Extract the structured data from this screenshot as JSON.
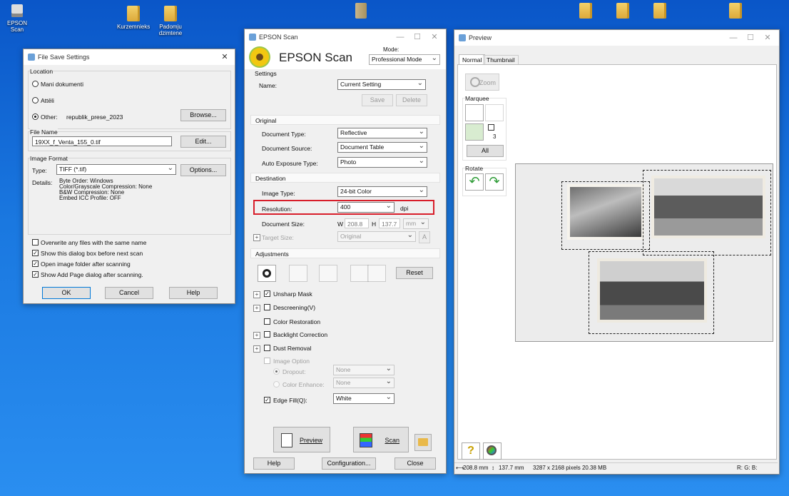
{
  "desktop": {
    "icons": [
      {
        "label": "EPSON Scan"
      },
      {
        "label": "Kurzemnieks"
      },
      {
        "label": "Padomju dzimtene"
      }
    ]
  },
  "file_save": {
    "title": "File Save Settings",
    "location_label": "Location",
    "opt1": "Mani dokumenti",
    "opt2": "Attēli",
    "opt3": "Other:",
    "other_path": "republik_prese_2023",
    "browse": "Browse...",
    "filename_label": "File Name",
    "filename_value": "19XX_f_Venta_155_0.tif",
    "edit": "Edit...",
    "format_label": "Image Format",
    "type_label": "Type:",
    "type_value": "TIFF (*.tif)",
    "options": "Options...",
    "details_label": "Details:",
    "details": [
      "Byte Order: Windows",
      "Color/Grayscale Compression: None",
      "B&W Compression: None",
      "Embed ICC Profile: OFF"
    ],
    "cb1": "Overwrite any files with the same name",
    "cb2": "Show this dialog box before next scan",
    "cb3": "Open image folder after scanning",
    "cb4": "Show Add Page dialog after scanning.",
    "ok": "OK",
    "cancel": "Cancel",
    "help": "Help"
  },
  "epson": {
    "title": "EPSON Scan",
    "brand": "EPSON Scan",
    "mode_label": "Mode:",
    "mode_value": "Professional Mode",
    "settings_label": "Settings",
    "name_label": "Name:",
    "name_value": "Current Setting",
    "save": "Save",
    "delete": "Delete",
    "original": "Original",
    "doc_type_label": "Document Type:",
    "doc_type": "Reflective",
    "doc_source_label": "Document Source:",
    "doc_source": "Document Table",
    "auto_exp_label": "Auto Exposure Type:",
    "auto_exp": "Photo",
    "destination": "Destination",
    "image_type_label": "Image Type:",
    "image_type": "24-bit Color",
    "resolution_label": "Resolution:",
    "resolution": "400",
    "dpi": "dpi",
    "doc_size_label": "Document Size:",
    "w": "W",
    "w_val": "208.8",
    "h": "H",
    "h_val": "137.7",
    "unit": "mm",
    "target_size_label": "Target Size:",
    "target_size": "Original",
    "adjustments": "Adjustments",
    "reset": "Reset",
    "unsharp": "Unsharp Mask",
    "descreening": "Descreening(V)",
    "color_restoration": "Color Restoration",
    "backlight": "Backlight Correction",
    "dust": "Dust Removal",
    "image_option": "Image Option",
    "dropout": "Dropout:",
    "dropout_val": "None",
    "color_enhance": "Color Enhance:",
    "color_enhance_val": "None",
    "edge_fill": "Edge Fill(Q):",
    "edge_fill_val": "White",
    "preview": "Preview",
    "scan": "Scan",
    "help": "Help",
    "configuration": "Configuration...",
    "close": "Close"
  },
  "preview": {
    "title": "Preview",
    "tab_normal": "Normal",
    "tab_thumb": "Thumbnail",
    "zoom": "Zoom",
    "marquee": "Marquee",
    "marquee_count": "3",
    "all": "All",
    "rotate": "Rotate",
    "status_size": "208.8 mm",
    "status_height": "137.7 mm",
    "status_pixels": "3287 x 2168 pixels 20.38 MB",
    "status_rgb": "R: G: B:"
  },
  "colors": {
    "desktop": "#1a6fe0",
    "highlight": "#d81e2a"
  }
}
